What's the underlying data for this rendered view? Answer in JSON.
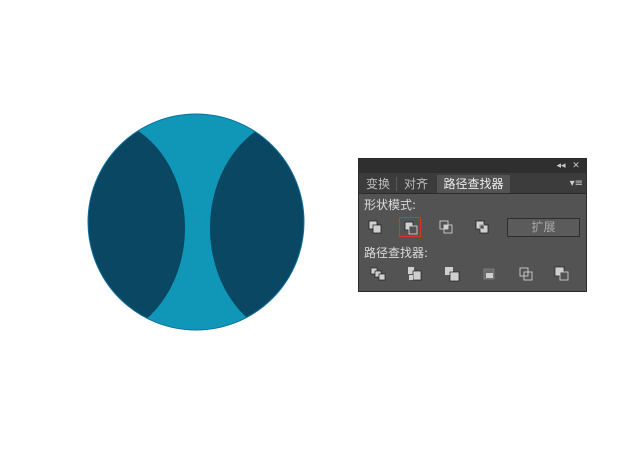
{
  "colors": {
    "circle_light": "#1096b6",
    "circle_dark": "#0a4763",
    "panel_bg": "#535353",
    "selection_border": "#e0312b"
  },
  "artwork": {
    "shape": "circle with two dark curved side segments"
  },
  "panel": {
    "collapse_glyph": "◂◂",
    "close_glyph": "✕",
    "tabs": [
      {
        "label": "变换",
        "active": false
      },
      {
        "label": "对齐",
        "active": false
      },
      {
        "label": "路径查找器",
        "active": true
      }
    ],
    "menu_glyph": "▾≡",
    "shape_modes_label": "形状模式:",
    "shape_mode_buttons": [
      {
        "icon": "unite-icon",
        "selected": false
      },
      {
        "icon": "minus-front-icon",
        "selected": true
      },
      {
        "icon": "intersect-icon",
        "selected": false
      },
      {
        "icon": "exclude-icon",
        "selected": false
      }
    ],
    "expand_label": "扩展",
    "pathfinders_label": "路径查找器:",
    "pathfinder_buttons": [
      {
        "icon": "divide-icon"
      },
      {
        "icon": "trim-icon"
      },
      {
        "icon": "merge-icon"
      },
      {
        "icon": "crop-icon"
      },
      {
        "icon": "outline-icon"
      },
      {
        "icon": "minus-back-icon"
      }
    ]
  }
}
